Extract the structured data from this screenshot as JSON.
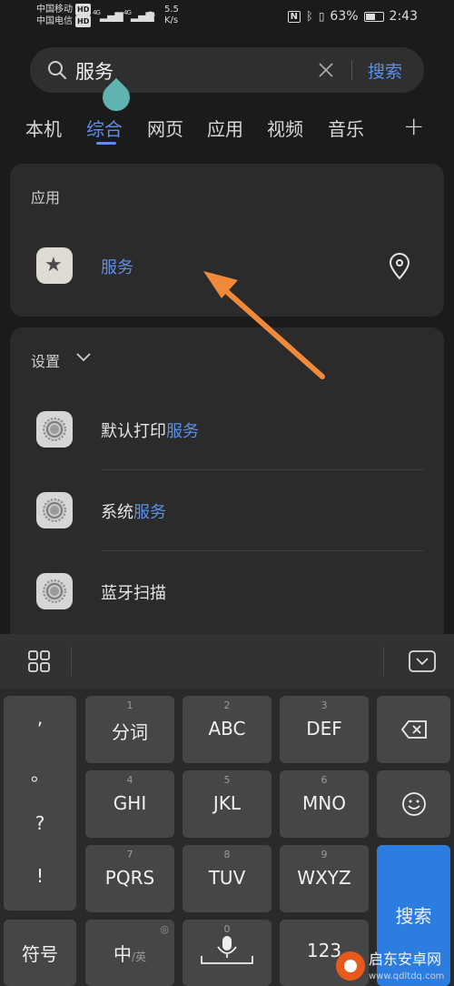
{
  "status": {
    "carrier1": "中国移动",
    "carrier2": "中国电信",
    "hd": "HD",
    "net1": "4G",
    "net2": "4G",
    "speed_value": "5.5",
    "speed_unit": "K/s",
    "battery_pct": "63%",
    "battery_level": 0.63,
    "time": "2:43"
  },
  "search": {
    "query": "服务",
    "button": "搜索"
  },
  "tabs": [
    {
      "label": "本机"
    },
    {
      "label": "综合",
      "active": true
    },
    {
      "label": "网页"
    },
    {
      "label": "应用"
    },
    {
      "label": "视频"
    },
    {
      "label": "音乐"
    }
  ],
  "tab_add": "+",
  "apps_section": {
    "title": "应用",
    "app_name": "服务"
  },
  "settings_section": {
    "title": "设置",
    "items": [
      {
        "prefix": "默认打印",
        "highlight": "服务"
      },
      {
        "prefix": "系统",
        "highlight": "服务"
      },
      {
        "prefix": "蓝牙扫描",
        "highlight": ""
      }
    ]
  },
  "keyboard": {
    "punct": [
      ",",
      "。",
      "?",
      "!"
    ],
    "keys": [
      {
        "num": "1",
        "label": "分词"
      },
      {
        "num": "2",
        "label": "ABC"
      },
      {
        "num": "3",
        "label": "DEF"
      },
      {
        "num": "4",
        "label": "GHI"
      },
      {
        "num": "5",
        "label": "JKL"
      },
      {
        "num": "6",
        "label": "MNO"
      },
      {
        "num": "7",
        "label": "PQRS"
      },
      {
        "num": "8",
        "label": "TUV"
      },
      {
        "num": "9",
        "label": "WXYZ"
      }
    ],
    "symbol_key": "符号",
    "lang_main": "中",
    "lang_sub": "/英",
    "space_num": "0",
    "num_key": "123",
    "search_key": "搜索"
  },
  "watermark": {
    "line1": "启东安卓网",
    "line2": "www.qdltdq.com"
  },
  "colors": {
    "accent": "#5b8fe8",
    "arrow": "#f08a3a",
    "search_key": "#2d7de0"
  }
}
